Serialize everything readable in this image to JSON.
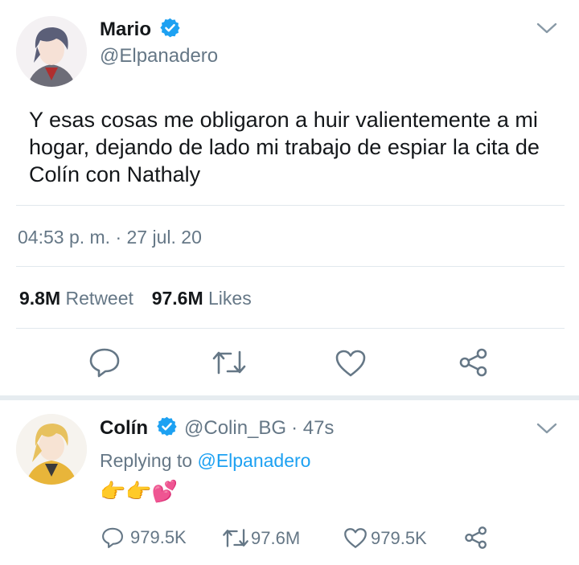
{
  "main_tweet": {
    "author_name": "Mario",
    "author_handle": "@Elpanadero",
    "text": "Y esas cosas me obligaron a huir valientemente a mi hogar, dejando de lado mi trabajo de espiar la cita de Colín con Nathaly",
    "timestamp": "04:53 p. m. · 27 jul. 20",
    "retweet_count": "9.8M",
    "retweet_label": "Retweet",
    "likes_count": "97.6M",
    "likes_label": "Likes",
    "icons": [
      "reply-icon",
      "retweet-icon",
      "like-icon",
      "share-icon",
      "chevron-down-icon",
      "verified-badge-icon"
    ]
  },
  "reply_tweet": {
    "author_name": "Colín",
    "author_handle": "@Colin_BG",
    "time_ago": "· 47s",
    "replying_prefix": "Replying to",
    "replying_handle": "@Elpanadero",
    "text": "👉👉💕",
    "reply_count": "979.5K",
    "retweet_count": "97.6M",
    "like_count": "979.5K"
  },
  "colors": {
    "verified_blue": "#1da1f2",
    "muted_text": "#657786",
    "divider": "#e1e8ed",
    "icon_gray": "#657786"
  }
}
